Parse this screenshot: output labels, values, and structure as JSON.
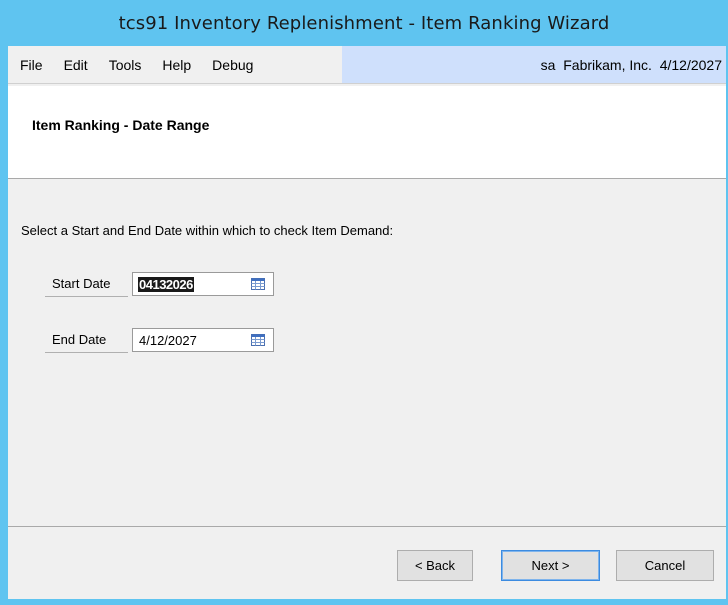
{
  "window": {
    "title": "tcs91 Inventory Replenishment - Item Ranking Wizard"
  },
  "menu": {
    "items": [
      {
        "label": "File"
      },
      {
        "label": "Edit"
      },
      {
        "label": "Tools"
      },
      {
        "label": "Help"
      },
      {
        "label": "Debug"
      }
    ],
    "user_info": "sa  Fabrikam, Inc.  4/12/2027"
  },
  "header": {
    "title": "Item Ranking - Date Range"
  },
  "body": {
    "instruction": "Select a Start and End Date within which to check Item Demand:",
    "start_date": {
      "label": "Start Date",
      "value": "04132026"
    },
    "end_date": {
      "label": "End Date",
      "value": "4/12/2027"
    }
  },
  "buttons": {
    "back": "< Back",
    "next": "Next >",
    "cancel": "Cancel"
  },
  "colors": {
    "titlebar": "#5fc4f0",
    "user_info_bg": "#cfe0fc",
    "client_bg": "#f0f0f0"
  }
}
